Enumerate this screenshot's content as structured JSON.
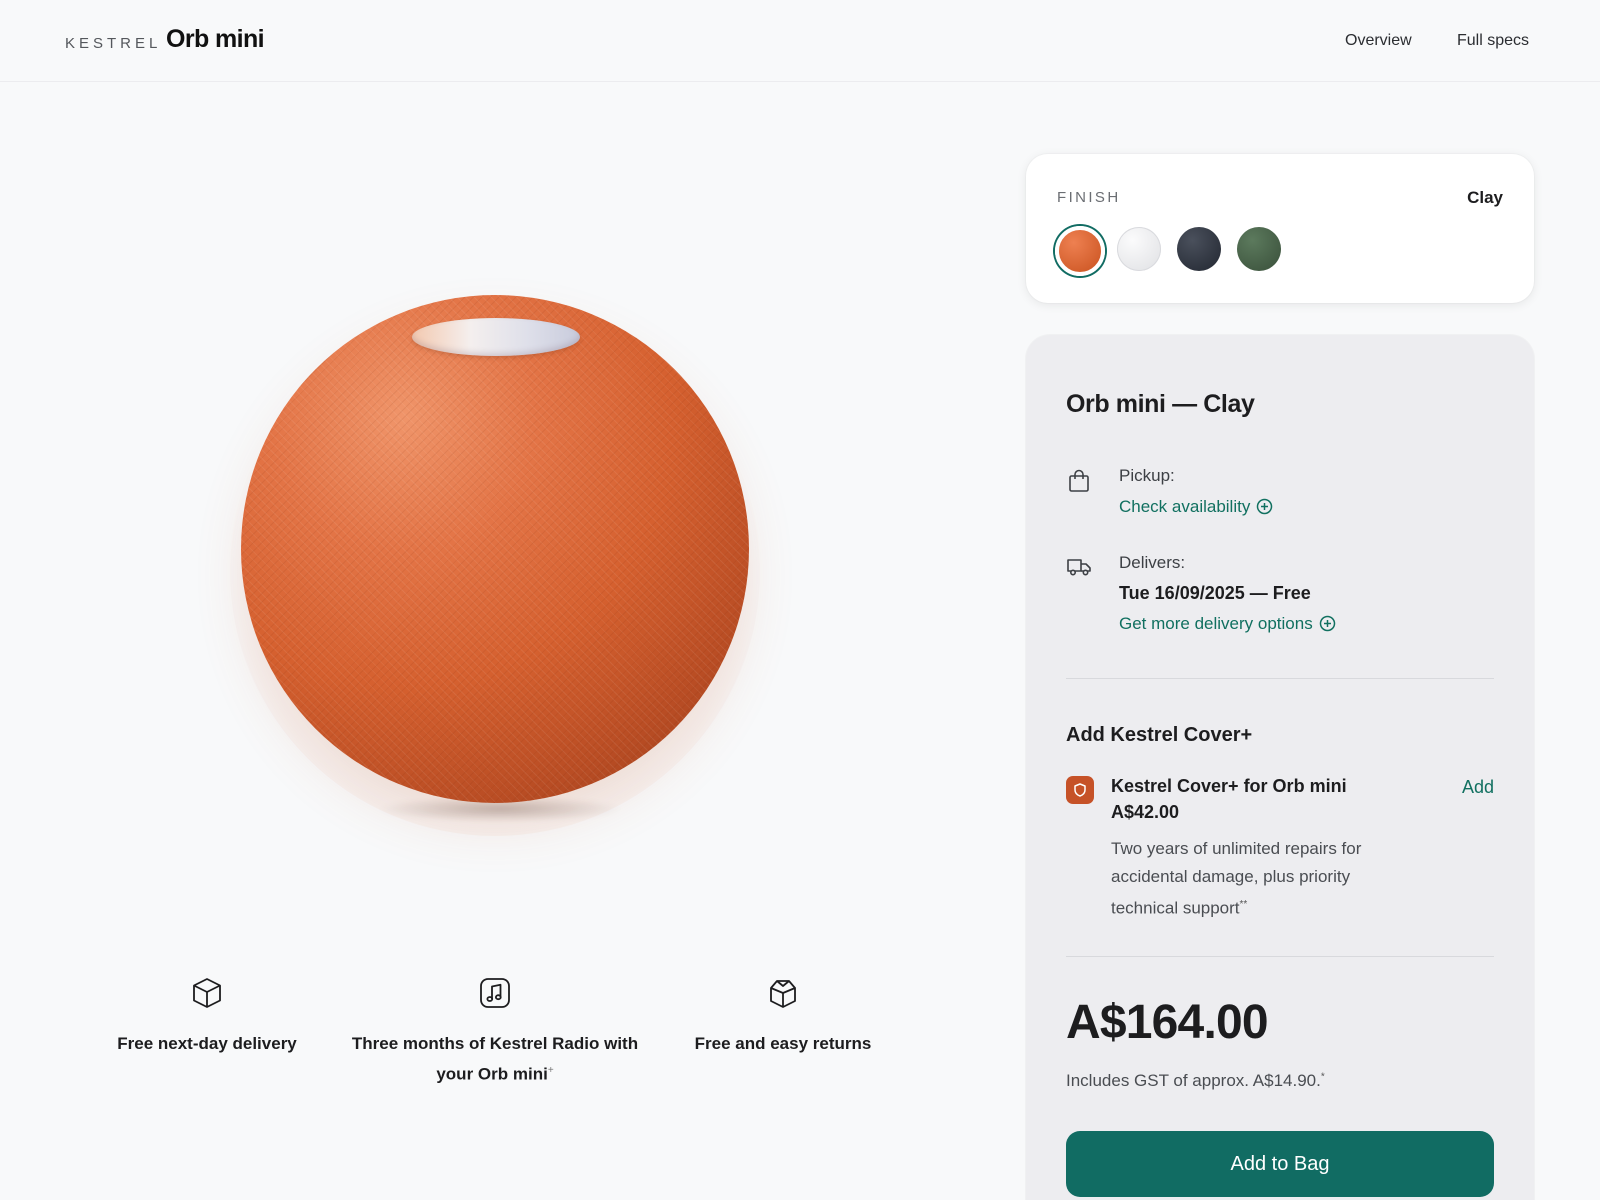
{
  "header": {
    "brand": "KESTREL",
    "product": "Orb mini",
    "nav": {
      "overview": "Overview",
      "full_specs": "Full specs"
    }
  },
  "features": [
    {
      "icon": "cube-icon",
      "text": "Free next-day delivery"
    },
    {
      "icon": "music-note-icon",
      "text": "Three months of Kestrel Radio with your Orb mini",
      "mark": "+"
    },
    {
      "icon": "open-box-icon",
      "text": "Free and easy returns"
    }
  ],
  "finish": {
    "label": "FINISH",
    "selected": "Clay",
    "swatches": [
      {
        "name": "Clay",
        "color": "#d3602f",
        "selected": true
      },
      {
        "name": "White",
        "color": "#eeeef0"
      },
      {
        "name": "Midnight",
        "color": "#343a46"
      },
      {
        "name": "Green",
        "color": "#4b654b"
      }
    ]
  },
  "order": {
    "title": "Orb mini — Clay",
    "pickup_label": "Pickup:",
    "check_availability": "Check availability",
    "delivers_label": "Delivers:",
    "delivery_date": "Tue 16/09/2025 — Free",
    "more_delivery": "Get more delivery options",
    "cover": {
      "heading": "Add Kestrel Cover+",
      "name": "Kestrel Cover+ for Orb mini",
      "price": "A$42.00",
      "add_label": "Add",
      "description": "Two years of unlimited repairs for accidental damage, plus priority technical support",
      "description_mark": "**"
    },
    "price": "A$164.00",
    "price_note": "Includes GST of approx. A$14.90.",
    "price_note_mark": "*",
    "add_to_bag": "Add to Bag"
  },
  "colors": {
    "accent": "#116c63",
    "clay": "#d3602f",
    "panel": "#ededf0",
    "background": "#f8f9fa"
  }
}
